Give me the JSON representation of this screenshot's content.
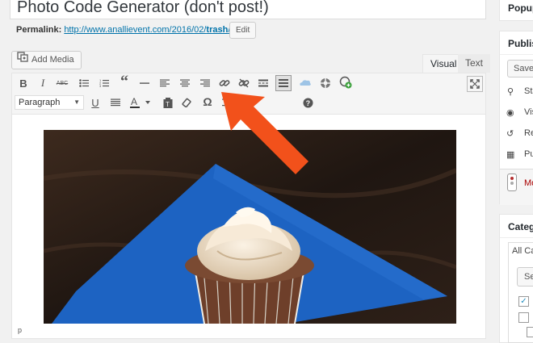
{
  "post": {
    "title": "Photo Code Generator (don't post!)",
    "permalink_label": "Permalink:",
    "permalink_base": "http://www.anallievent.com/2016/02/",
    "permalink_slug": "trash",
    "permalink_end": "/",
    "edit_label": "Edit"
  },
  "editor": {
    "add_media_label": "Add Media",
    "tab_visual": "Visual",
    "tab_text": "Text",
    "format_select": "Paragraph",
    "status_path": "p",
    "toolbar_row1": [
      "bold-icon",
      "italic-icon",
      "strikethrough-icon",
      "bulleted-list-icon",
      "numbered-list-icon",
      "blockquote-icon",
      "horizontal-line-icon",
      "align-left-icon",
      "align-center-icon",
      "align-right-icon",
      "insert-link-icon",
      "remove-link-icon",
      "read-more-icon",
      "toolbar-toggle-icon",
      "cloud-icon",
      "life-ring-icon",
      "add-media-plus-icon",
      "fullscreen-icon"
    ],
    "toolbar_row2": [
      "underline-icon",
      "justify-icon",
      "text-color-icon",
      "paste-text-icon",
      "clear-formatting-icon",
      "special-character-icon",
      "indent-icon",
      "help-icon"
    ]
  },
  "sidebar": {
    "popup_title": "Popup",
    "publish_title": "Publis",
    "save_label": "Save",
    "status_label": "Sta",
    "visibility_label": "Vis",
    "revisions_label": "Re",
    "publish_date_label": "Pu",
    "move_trash_label": "Mo",
    "categories_title": "Categ",
    "all_categories_tab": "All Ca",
    "select_label": "Sel"
  },
  "colors": {
    "arrow": "#f2511b",
    "link": "#0073aa",
    "napkin": "#1d63c2"
  }
}
